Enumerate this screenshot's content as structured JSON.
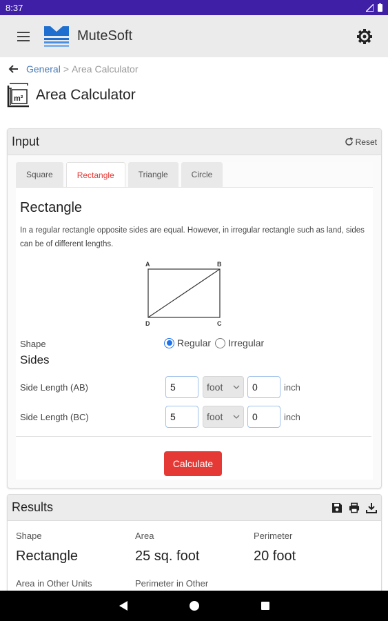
{
  "status": {
    "time": "8:37"
  },
  "appbar": {
    "title": "MuteSoft"
  },
  "breadcrumb": {
    "parent": "General",
    "separator": ">",
    "current": "Area Calculator"
  },
  "page": {
    "title": "Area Calculator",
    "icon_label": "m²"
  },
  "input_card": {
    "title": "Input",
    "reset_label": "Reset",
    "tabs": [
      {
        "label": "Square",
        "active": false
      },
      {
        "label": "Rectangle",
        "active": true
      },
      {
        "label": "Triangle",
        "active": false
      },
      {
        "label": "Circle",
        "active": false
      }
    ],
    "shape_name": "Rectangle",
    "description": "In a regular rectangle opposite sides are equal. However, in irregular rectangle such as land, sides can be of different lengths.",
    "diagram": {
      "corner_a": "A",
      "corner_b": "B",
      "corner_c": "C",
      "corner_d": "D"
    },
    "shape_label": "Shape",
    "shape_options": {
      "regular": "Regular",
      "irregular": "Irregular",
      "selected": "Regular"
    },
    "sides_heading": "Sides",
    "sides": [
      {
        "label": "Side Length (AB)",
        "value": "5",
        "unit": "foot",
        "inch_value": "0",
        "inch_label": "inch"
      },
      {
        "label": "Side Length (BC)",
        "value": "5",
        "unit": "foot",
        "inch_value": "0",
        "inch_label": "inch"
      }
    ],
    "calculate_label": "Calculate"
  },
  "results_card": {
    "title": "Results",
    "shape_label": "Shape",
    "shape_value": "Rectangle",
    "area_label": "Area",
    "area_value": "25 sq. foot",
    "perimeter_label": "Perimeter",
    "perimeter_value": "20 foot",
    "area_other_label": "Area in Other Units",
    "perimeter_other_label": "Perimeter in Other"
  },
  "colors": {
    "status_bar": "#3f1fa6",
    "accent_red": "#e53935",
    "link_blue": "#4a7bb7",
    "radio_blue": "#1e73e8",
    "logo_blue": "#1e6fd0"
  }
}
